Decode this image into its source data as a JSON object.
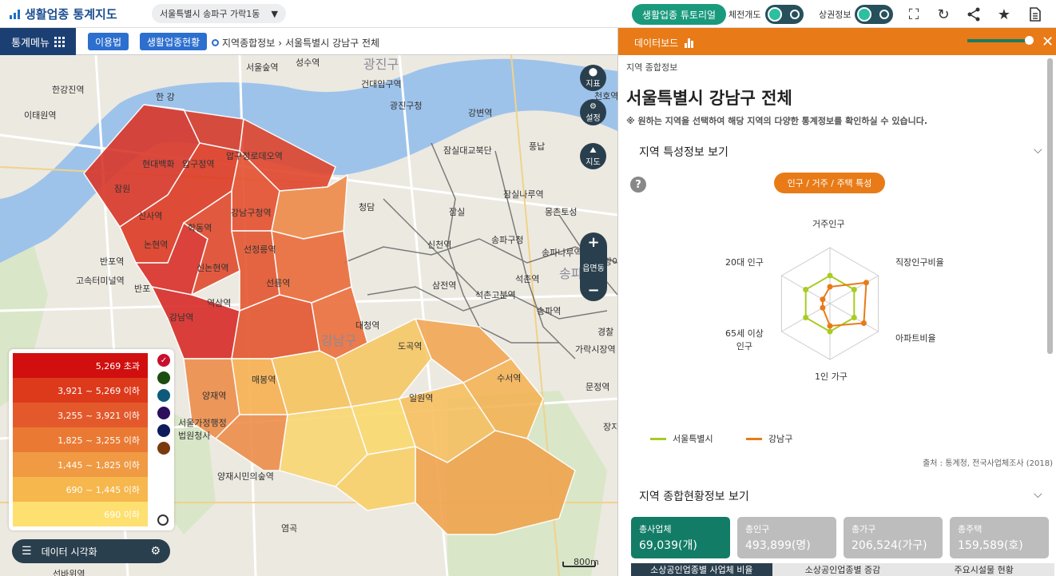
{
  "header": {
    "app_title": "생활업종 통계지도",
    "region_select": "서울특별시 송파구 가락1동",
    "tutorial_label": "생활업종 튜토리얼",
    "toggle1_label": "체전개도",
    "toggle2_label": "상권정보"
  },
  "menubar": {
    "stat_menu": "통계메뉴",
    "usage_btn": "이용법",
    "status_btn": "생활업종현황",
    "breadcrumb": [
      "지역종합정보",
      "서울특별시 강남구 전체"
    ]
  },
  "map": {
    "labels": {
      "river": "한 강",
      "seongsu": "성수역",
      "seoulsup": "서울숲역",
      "geondae": "건대입구역",
      "gwangjin": "광진구청",
      "gangbyeon": "강변역",
      "jamsildaegyo": "잠실대교북단",
      "pungnap": "풍납",
      "jamwon": "잠원",
      "cheongdam": "청담",
      "jamsil": "잠실",
      "jamsilnaru": "잠실나루역",
      "sinsa": "신사역",
      "hyundai": "현대백화",
      "apgujeong": "압구정역",
      "apgujeong_rodeo": "압구정로데오역",
      "gangnamgu_office": "강남구청역",
      "hakdong": "학동역",
      "seonjeongneung": "선정릉역",
      "seolleung": "선릉역",
      "gangnam": "강남역",
      "yeoksam": "역삼역",
      "banpo": "반포",
      "banpo_station": "반포역",
      "express_terminal": "고속터미널역",
      "nonhyeon": "논현역",
      "sinnonhyeon": "신논현역",
      "yangjae": "양재역",
      "court": "서울가정행정\n법원청사",
      "yangjae_citizen": "양재시민의숲역",
      "yeomgok": "염곡",
      "suseo": "수서역",
      "garak": "가락시장역",
      "songpa_office": "송파구청",
      "seokchon": "석촌역",
      "songpa": "송파역",
      "songpa_naru": "송파나루역",
      "samjeon": "삼전역",
      "seokchon_gobun": "석촌고분역",
      "mongchon": "몽촌토성",
      "sincheon": "신천역",
      "daecheong": "대청역",
      "ilwon": "일원역",
      "maebong": "매봉역",
      "dogok": "도곡역",
      "district_gangnam": "강남구",
      "district_songpa": "송파구",
      "district_gwangjin": "광진구",
      "hangang_gu": "한강진역",
      "itaewon": "이태원역",
      "scale": "800m",
      "cheonho": "천호역",
      "jangji": "장지",
      "munjeong": "문정역",
      "bangi": "방이",
      "gyeongchal": "경찰",
      "seonbawi": "선바위역"
    },
    "controls": {
      "indicator": "지표",
      "settings": "설정",
      "map": "지도",
      "zoom_level": "읍면동",
      "plus": "+",
      "minus": "−"
    }
  },
  "legend": {
    "ranges": [
      "5,269 초과",
      "3,921 ~ 5,269 이하",
      "3,255 ~ 3,921 이하",
      "1,825 ~ 3,255 이하",
      "1,445 ~ 1,825 이하",
      "690 ~ 1,445 이하",
      "690 이하"
    ],
    "colors": [
      "#d10f0f",
      "#dd3a1c",
      "#e4592b",
      "#ea7a33",
      "#f09a43",
      "#f6b74c",
      "#fde070"
    ],
    "swatch_colors": [
      "#c8102e",
      "#1a4d0f",
      "#0d5a7a",
      "#2b0d5c",
      "#0d1a5c",
      "#7a3a0d"
    ],
    "viz_label": "데이터 시각화"
  },
  "panel": {
    "dashboard_label": "데이터보드",
    "breadcrumb": "지역 종합정보",
    "title": "서울특별시 강남구 전체",
    "hint": "※ 원하는 지역을 선택하여 해당 지역의 다양한 통계정보를 확인하실 수 있습니다.",
    "section1": "지역 특성정보 보기",
    "pill_label": "인구 / 거주 / 주택 특성",
    "section2": "지역 종합현황정보 보기",
    "source": "출처 : 통계청, 전국사업체조사 (2018)",
    "radar": {
      "axes": [
        "거주인구",
        "직장인구비율",
        "아파트비율",
        "1인 가구",
        "65세 이상\n인구",
        "20대 인구"
      ],
      "series": [
        {
          "name": "서울특별시",
          "color": "#a8cc22",
          "values": [
            0.5,
            0.5,
            0.5,
            0.5,
            0.5,
            0.5
          ]
        },
        {
          "name": "강남구",
          "color": "#e87b17",
          "values": [
            0.3,
            0.75,
            0.7,
            0.4,
            0.15,
            0.15
          ]
        }
      ]
    },
    "cards": [
      {
        "label": "총사업체",
        "value": "69,039(개)"
      },
      {
        "label": "총인구",
        "value": "493,899(명)"
      },
      {
        "label": "총가구",
        "value": "206,524(가구)"
      },
      {
        "label": "총주택",
        "value": "159,589(호)"
      }
    ],
    "bottom_tabs": [
      "소상공인업종별 사업체 비율",
      "소상공인업종별 증감",
      "주요시설물 현황"
    ]
  }
}
